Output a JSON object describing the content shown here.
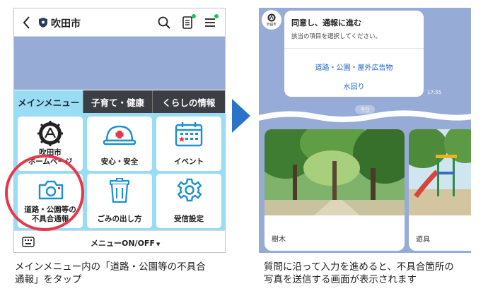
{
  "left_screen": {
    "header": {
      "account_name": "吹田市"
    },
    "tabs": [
      {
        "label": "メインメニュー"
      },
      {
        "label": "子育て・健康"
      },
      {
        "label": "くらしの情報"
      }
    ],
    "menu_items": [
      {
        "label_line1": "吹田市",
        "label_line2": "ホームページ"
      },
      {
        "label_line1": "安心・安全"
      },
      {
        "label_line1": "イベント"
      },
      {
        "label_line1": "道路・公園等の",
        "label_line2": "不具合通報"
      },
      {
        "label_line1": "ごみの出し方"
      },
      {
        "label_line1": "受信設定"
      }
    ],
    "bottom_bar": {
      "menu_toggle_label": "メニューON/OFF"
    }
  },
  "right_screen": {
    "bot_avatar_text": "吹田市",
    "bubble": {
      "title": "同意し、通報に進む",
      "subtitle": "該当の項目を選択してください。",
      "options": [
        "道路・公園・屋外広告物",
        "水回り"
      ],
      "time": "17:55"
    },
    "date_pill": "今日",
    "photo_cards": [
      {
        "label": "樹木"
      },
      {
        "label": "遊具"
      }
    ]
  },
  "captions": {
    "left": [
      "メインメニュー内の「道路・公園等の不具合",
      "通報」をタップ"
    ],
    "right": [
      "質問に沿って入力を進めると、不具合箇所の",
      "写真を送信する画面が表示されます"
    ]
  },
  "colors": {
    "menu_background": "#9adcf3",
    "chat_background": "#97abd7",
    "tab_dark": "#3b3f44",
    "highlight_red": "#e8364a",
    "arrow_blue": "#2a73c9",
    "link_blue": "#1f63c9",
    "notify_green": "#19c35b"
  }
}
